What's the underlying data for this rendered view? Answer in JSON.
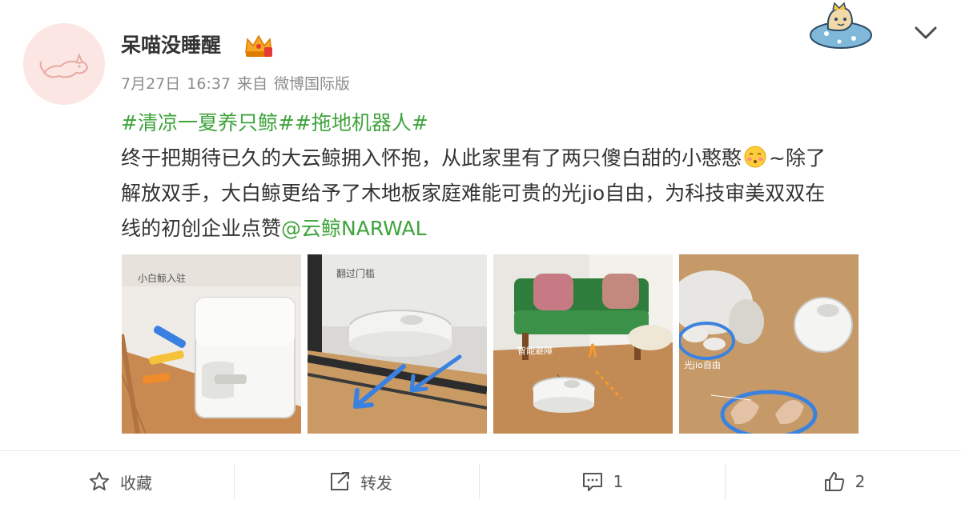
{
  "user": {
    "name": "呆喵没睡醒",
    "post_date": "7月27日",
    "post_time": "16:37",
    "source_prefix": "来自",
    "source": "微博国际版"
  },
  "post": {
    "hashtags": "#清凉一夏养只鲸##拖地机器人#",
    "line1": "终于把期待已久的大云鲸拥入怀抱，从此家里有了两只傻白甜的小憨憨",
    "line1_tail": "~除了",
    "line2": "解放双手，大白鲸更给予了木地板家庭难能可贵的光jio自由，为科技审美双双在",
    "line3_text": "线的初创企业点赞",
    "mention": "@云鲸NARWAL"
  },
  "photos": [
    {
      "name": "robot-base-station",
      "caption": "小白鲸入驻"
    },
    {
      "name": "robot-on-track",
      "caption": "翻过门槛"
    },
    {
      "name": "robot-in-living-room",
      "caption": "智能避障"
    },
    {
      "name": "robot-with-cat",
      "caption": "光jio自由"
    }
  ],
  "actions": {
    "favorite": "收藏",
    "repost": "转发",
    "comment_count": "1",
    "like_count": "2"
  },
  "colors": {
    "accent_green": "#3fa33c",
    "text": "#333333",
    "meta": "#8c8c8c"
  },
  "icons": [
    "star-icon",
    "repost-icon",
    "comment-icon",
    "thumbs-up-icon",
    "chevron-down-icon",
    "vip-crown-icon",
    "avatar-cat-icon",
    "blushing-face-emoji"
  ]
}
